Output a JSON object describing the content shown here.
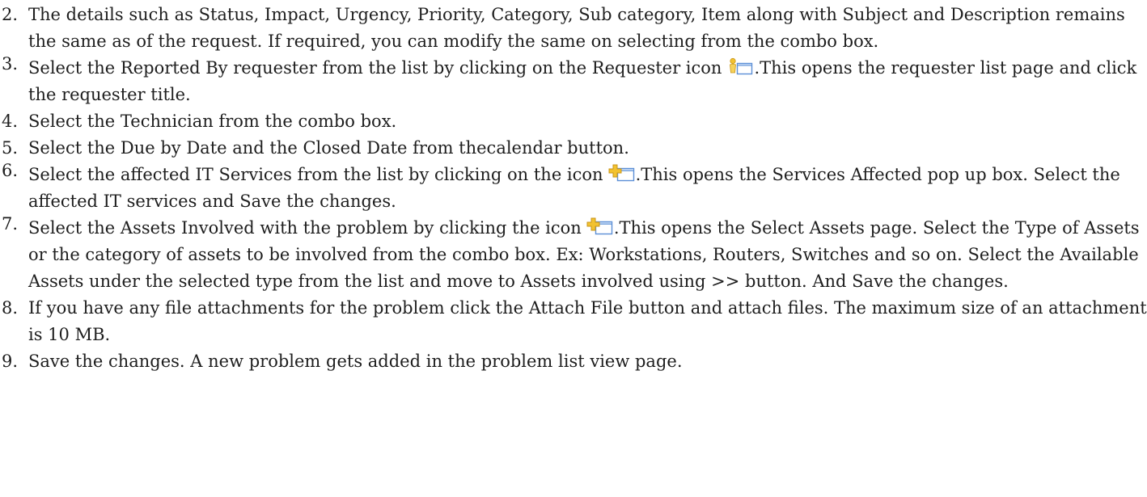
{
  "steps": [
    {
      "number": "2.",
      "text": "The details such as Status, Impact, Urgency, Priority, Category, Sub category, Item along with Subject and Description remains the same as of the request. If required, you can modify the same on selecting from the combo box."
    },
    {
      "number": "3.",
      "text_before": "Select the Reported By requester from the list by clicking on the Requester icon",
      "icon": "requester-icon",
      "text_after": ".This opens the requester list page and click the requester title."
    },
    {
      "number": "4.",
      "text": "Select the Technician from the combo box."
    },
    {
      "number": "5.",
      "text": "Select the Due by Date and the Closed Date from thecalendar button."
    },
    {
      "number": "6.",
      "text_before": "Select the affected IT Services from the list by clicking on the icon",
      "icon": "add-icon",
      "text_after": ".This opens the Services Affected pop up box. Select the affected IT services and Save the changes."
    },
    {
      "number": "7.",
      "text_before": "Select the Assets Involved with the problem by clicking the icon",
      "icon": "add-icon",
      "text_after": ".This opens the Select Assets page. Select the Type of Assets or the category of assets to be involved from the combo box. Ex: Workstations, Routers, Switches and so on. Select the Available Assets under the selected type from the list and move to Assets involved using >> button. And Save the changes."
    },
    {
      "number": "8.",
      "text": "If you have any file attachments for the problem click the Attach File button and attach files. The maximum size of an attachment is 10 MB."
    },
    {
      "number": "9.",
      "text": " Save the changes. A new problem gets added in the problem list view page."
    }
  ],
  "colors": {
    "text": "#1e1e1e",
    "icon_yellow": "#f2c230",
    "icon_blue": "#5b8fd6"
  }
}
